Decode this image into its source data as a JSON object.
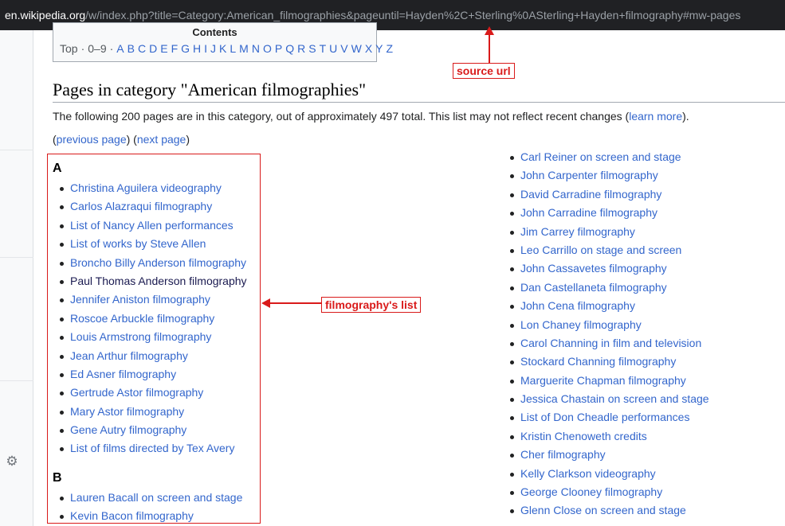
{
  "urlbar": {
    "host": "en.wikipedia.org",
    "path": "/w/index.php?title=Category:American_filmographies&pageuntil=Hayden%2C+Sterling%0ASterling+Hayden+filmography#mw-pages"
  },
  "toc": {
    "title": "Contents",
    "links": [
      "Top",
      "0–9",
      "A",
      "B",
      "C",
      "D",
      "E",
      "F",
      "G",
      "H",
      "I",
      "J",
      "K",
      "L",
      "M",
      "N",
      "O",
      "P",
      "Q",
      "R",
      "S",
      "T",
      "U",
      "V",
      "W",
      "X",
      "Y",
      "Z"
    ]
  },
  "heading": "Pages in category \"American filmographies\"",
  "intro": {
    "text": "The following 200 pages are in this category, out of approximately 497 total. This list may not reflect recent changes (",
    "link": "learn more",
    "end": ")."
  },
  "pager": {
    "prev": "previous page",
    "next": "next page"
  },
  "left_column": {
    "groups": [
      {
        "letter": "A",
        "items": [
          "Christina Aguilera videography",
          "Carlos Alazraqui filmography",
          "List of Nancy Allen performances",
          "List of works by Steve Allen",
          "Broncho Billy Anderson filmography",
          "Paul Thomas Anderson filmography",
          "Jennifer Aniston filmography",
          "Roscoe Arbuckle filmography",
          "Louis Armstrong filmography",
          "Jean Arthur filmography",
          "Ed Asner filmography",
          "Gertrude Astor filmography",
          "Mary Astor filmography",
          "Gene Autry filmography",
          "List of films directed by Tex Avery"
        ]
      },
      {
        "letter": "B",
        "items": [
          "Lauren Bacall on screen and stage",
          "Kevin Bacon filmography"
        ]
      }
    ]
  },
  "right_column": {
    "items": [
      "Carl Reiner on screen and stage",
      "John Carpenter filmography",
      "David Carradine filmography",
      "John Carradine filmography",
      "Jim Carrey filmography",
      "Leo Carrillo on stage and screen",
      "John Cassavetes filmography",
      "Dan Castellaneta filmography",
      "John Cena filmography",
      "Lon Chaney filmography",
      "Carol Channing in film and television",
      "Stockard Channing filmography",
      "Marguerite Chapman filmography",
      "Jessica Chastain on screen and stage",
      "List of Don Cheadle performances",
      "Kristin Chenoweth credits",
      "Cher filmography",
      "Kelly Clarkson videography",
      "George Clooney filmography",
      "Glenn Close on screen and stage"
    ]
  },
  "annotations": {
    "source_url": "source url",
    "filmography_list": "filmography's list"
  },
  "colors": {
    "link": "#3366cc",
    "visited": "#1a1a50",
    "annotation": "#d91a1a"
  },
  "icons": {
    "settings": "gear-icon"
  }
}
